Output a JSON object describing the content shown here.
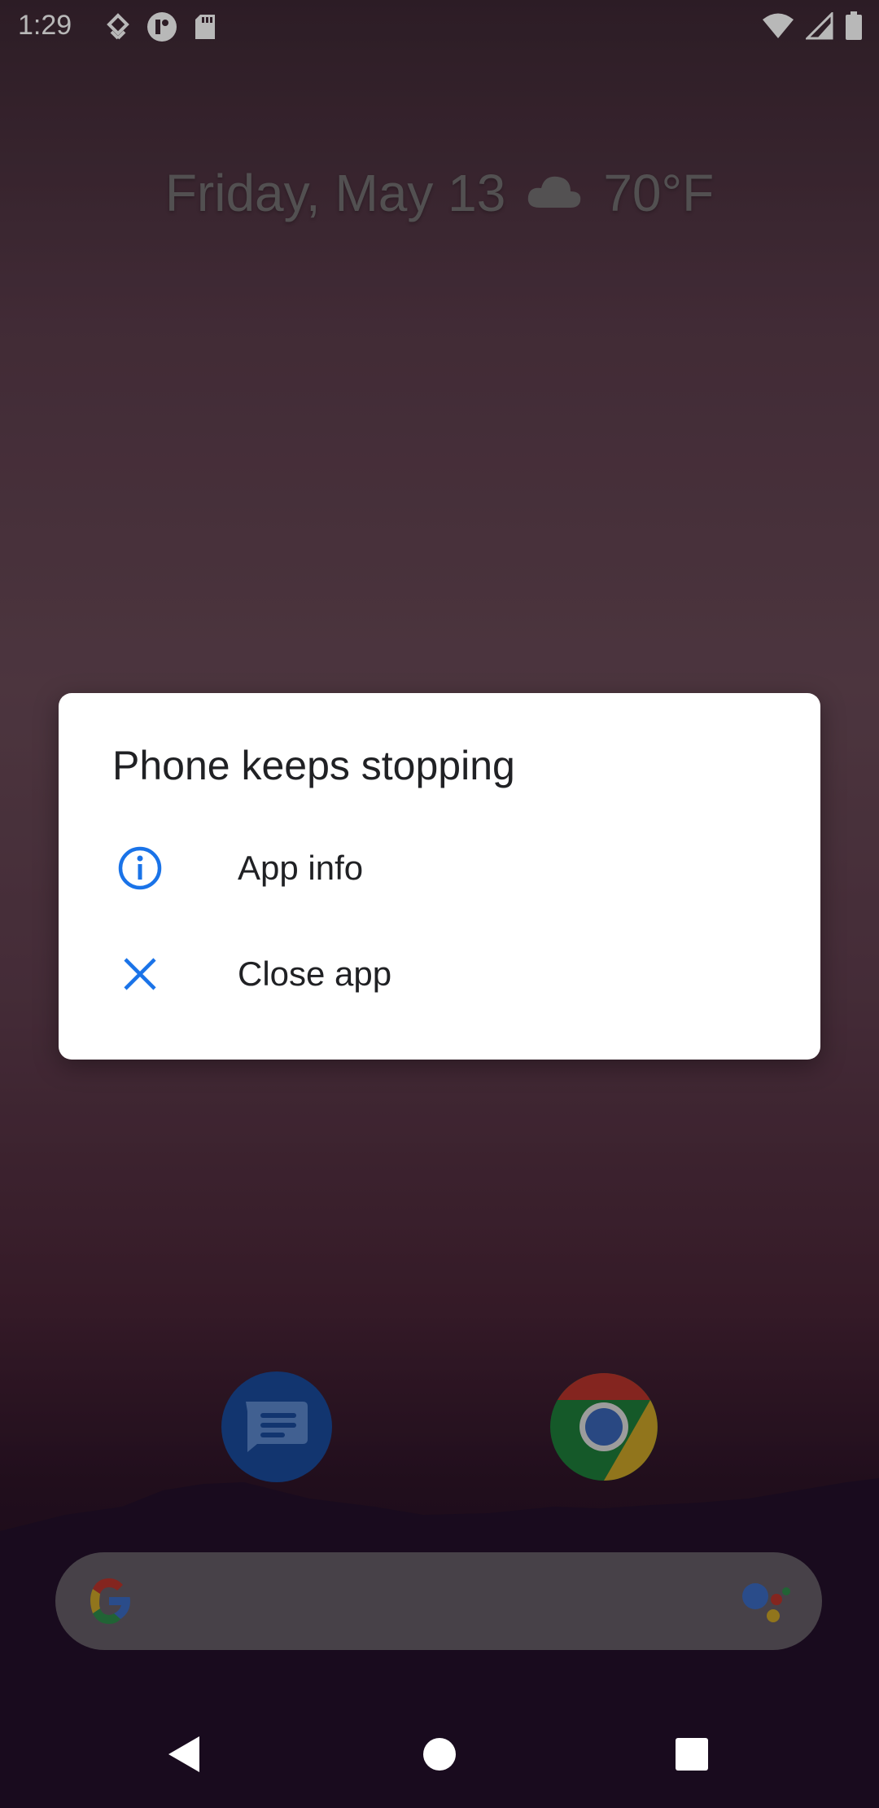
{
  "status_bar": {
    "time": "1:29",
    "left_icons": [
      "download-notification-icon",
      "app-notification-icon",
      "sd-card-icon"
    ],
    "right_icons": [
      "wifi-icon",
      "cell-signal-icon",
      "battery-icon"
    ]
  },
  "home": {
    "date": "Friday, May 13",
    "weather_icon": "cloud-icon",
    "temperature": "70°F",
    "dock_apps": [
      "messages-app",
      "chrome-app"
    ]
  },
  "dialog": {
    "title": "Phone keeps stopping",
    "items": [
      {
        "label": "App info",
        "icon": "info-icon"
      },
      {
        "label": "Close app",
        "icon": "close-icon"
      }
    ],
    "accent": "#1a73e8"
  },
  "nav": {
    "buttons": [
      "back-button",
      "home-button",
      "recents-button"
    ]
  }
}
